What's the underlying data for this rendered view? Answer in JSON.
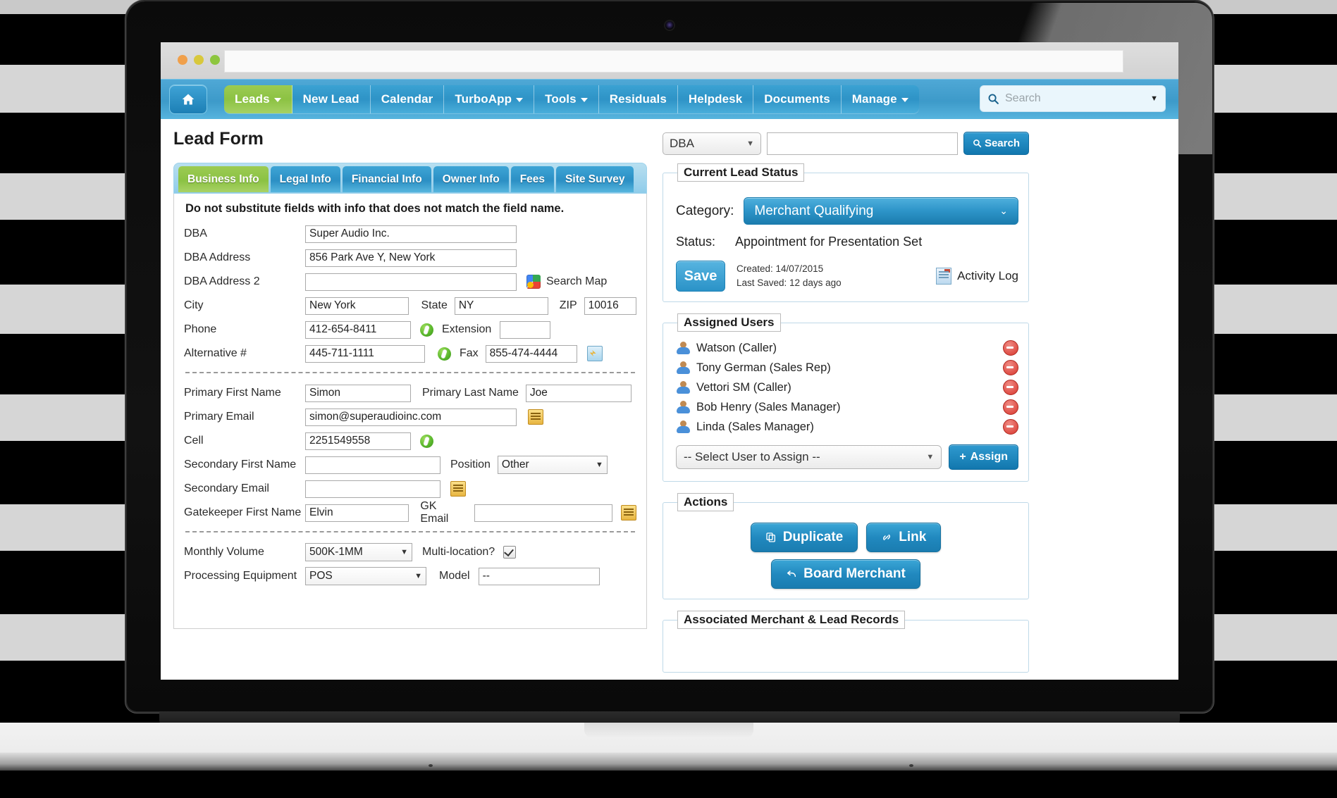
{
  "browser": {
    "url_value": "",
    "url_placeholder": ""
  },
  "nav": {
    "home_icon": "home-icon",
    "items": [
      {
        "label": "Leads",
        "caret": true,
        "active": true
      },
      {
        "label": "New Lead",
        "caret": false,
        "active": false
      },
      {
        "label": "Calendar",
        "caret": false,
        "active": false
      },
      {
        "label": "TurboApp",
        "caret": true,
        "active": false
      },
      {
        "label": "Tools",
        "caret": true,
        "active": false
      },
      {
        "label": "Residuals",
        "caret": false,
        "active": false
      },
      {
        "label": "Helpdesk",
        "caret": false,
        "active": false
      },
      {
        "label": "Documents",
        "caret": false,
        "active": false
      },
      {
        "label": "Manage",
        "caret": true,
        "active": false
      }
    ],
    "search": {
      "placeholder": "Search",
      "value": "",
      "icon": "search-icon"
    }
  },
  "page": {
    "title": "Lead Form"
  },
  "tabs": [
    {
      "label": "Business Info",
      "active": true
    },
    {
      "label": "Legal Info",
      "active": false
    },
    {
      "label": "Financial Info",
      "active": false
    },
    {
      "label": "Owner Info",
      "active": false
    },
    {
      "label": "Fees",
      "active": false
    },
    {
      "label": "Site Survey",
      "active": false
    }
  ],
  "form": {
    "notice": "Do not substitute fields with info that does not match the field name.",
    "dba_label": "DBA",
    "dba_value": "Super Audio Inc.",
    "dba_address_label": "DBA Address",
    "dba_address_value": "856 Park Ave Y, New York",
    "dba_address2_label": "DBA Address 2",
    "dba_address2_value": "",
    "search_map_label": "Search Map",
    "city_label": "City",
    "city_value": "New York",
    "state_label": "State",
    "state_value": "NY",
    "zip_label": "ZIP",
    "zip_value": "10016",
    "phone_label": "Phone",
    "phone_value": "412-654-8411",
    "extension_label": "Extension",
    "extension_value": "",
    "alternative_label": "Alternative #",
    "alternative_value": "445-711-1111",
    "fax_label": "Fax",
    "fax_value": "855-474-4444",
    "primary_first_label": "Primary First Name",
    "primary_first_value": "Simon",
    "primary_last_label": "Primary Last Name",
    "primary_last_value": "Joe",
    "primary_email_label": "Primary Email",
    "primary_email_value": "simon@superaudioinc.com",
    "cell_label": "Cell",
    "cell_value": "2251549558",
    "secondary_first_label": "Secondary First Name",
    "secondary_first_value": "",
    "position_label": "Position",
    "position_value": "Other",
    "secondary_email_label": "Secondary Email",
    "secondary_email_value": "",
    "gatekeeper_label": "Gatekeeper First Name",
    "gatekeeper_value": "Elvin",
    "gk_email_label": "GK Email",
    "gk_email_value": "",
    "monthly_volume_label": "Monthly Volume",
    "monthly_volume_value": "500K-1MM",
    "multi_location_label": "Multi-location?",
    "multi_location_checked": true,
    "processing_equipment_label": "Processing Equipment",
    "processing_equipment_value": "POS",
    "model_label": "Model",
    "model_value": "--"
  },
  "right": {
    "search_field_value": "DBA",
    "search_input_value": "",
    "search_button_label": "Search",
    "lead_status": {
      "legend": "Current Lead Status",
      "category_label": "Category:",
      "category_value": "Merchant Qualifying",
      "status_label": "Status:",
      "status_value": "Appointment for Presentation Set",
      "save_label": "Save",
      "created_text": "Created: 14/07/2015",
      "last_saved_text": "Last Saved: 12 days ago",
      "activity_log_label": "Activity Log"
    },
    "assigned_users": {
      "legend": "Assigned Users",
      "users": [
        {
          "name": "Watson (Caller)"
        },
        {
          "name": "Tony German (Sales Rep)"
        },
        {
          "name": "Vettori SM (Caller)"
        },
        {
          "name": "Bob Henry (Sales Manager)"
        },
        {
          "name": "Linda (Sales Manager)"
        }
      ],
      "select_placeholder": "-- Select User to Assign --",
      "assign_button_label": "Assign"
    },
    "actions": {
      "legend": "Actions",
      "duplicate_label": "Duplicate",
      "link_label": "Link",
      "board_merchant_label": "Board Merchant"
    },
    "associated": {
      "legend": "Associated Merchant & Lead Records"
    }
  },
  "colors": {
    "accent_blue": "#2e95c9",
    "accent_green": "#8bc243",
    "nav_blue": "#3d9ac9",
    "danger_red": "#d7352c"
  }
}
